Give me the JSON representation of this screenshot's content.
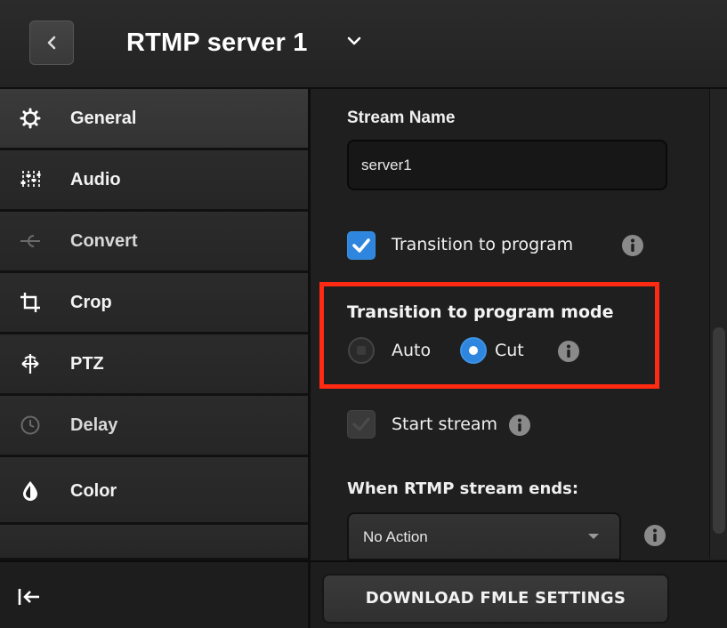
{
  "header": {
    "title": "RTMP server 1",
    "back_icon": "chevron-left-icon",
    "dropdown_icon": "chevron-down-icon"
  },
  "sidebar": {
    "items": [
      {
        "label": "General",
        "icon": "gear-icon",
        "active": true
      },
      {
        "label": "Audio",
        "icon": "audio-sliders-icon"
      },
      {
        "label": "Convert",
        "icon": "convert-icon",
        "disabled": true
      },
      {
        "label": "Crop",
        "icon": "crop-icon"
      },
      {
        "label": "PTZ",
        "icon": "ptz-icon"
      },
      {
        "label": "Delay",
        "icon": "clock-icon",
        "disabled": true
      },
      {
        "label": "Color",
        "icon": "color-drop-icon"
      }
    ],
    "collapse_icon": "collapse-left-icon"
  },
  "form": {
    "stream_name_label": "Stream Name",
    "stream_name_value": "server1",
    "transition_to_program_label": "Transition to program",
    "transition_to_program_checked": true,
    "transition_mode_label": "Transition to program mode",
    "mode_options": [
      {
        "label": "Auto",
        "selected": false
      },
      {
        "label": "Cut",
        "selected": true
      }
    ],
    "start_stream_label": "Start stream",
    "start_stream_checked": false,
    "stream_ends_label": "When RTMP stream ends:",
    "stream_ends_value": "No Action"
  },
  "footer": {
    "download_button_label": "DOWNLOAD FMLE SETTINGS"
  },
  "colors": {
    "accent": "#2e86de",
    "highlight": "#ff2a12",
    "background": "#1f1f1f"
  }
}
